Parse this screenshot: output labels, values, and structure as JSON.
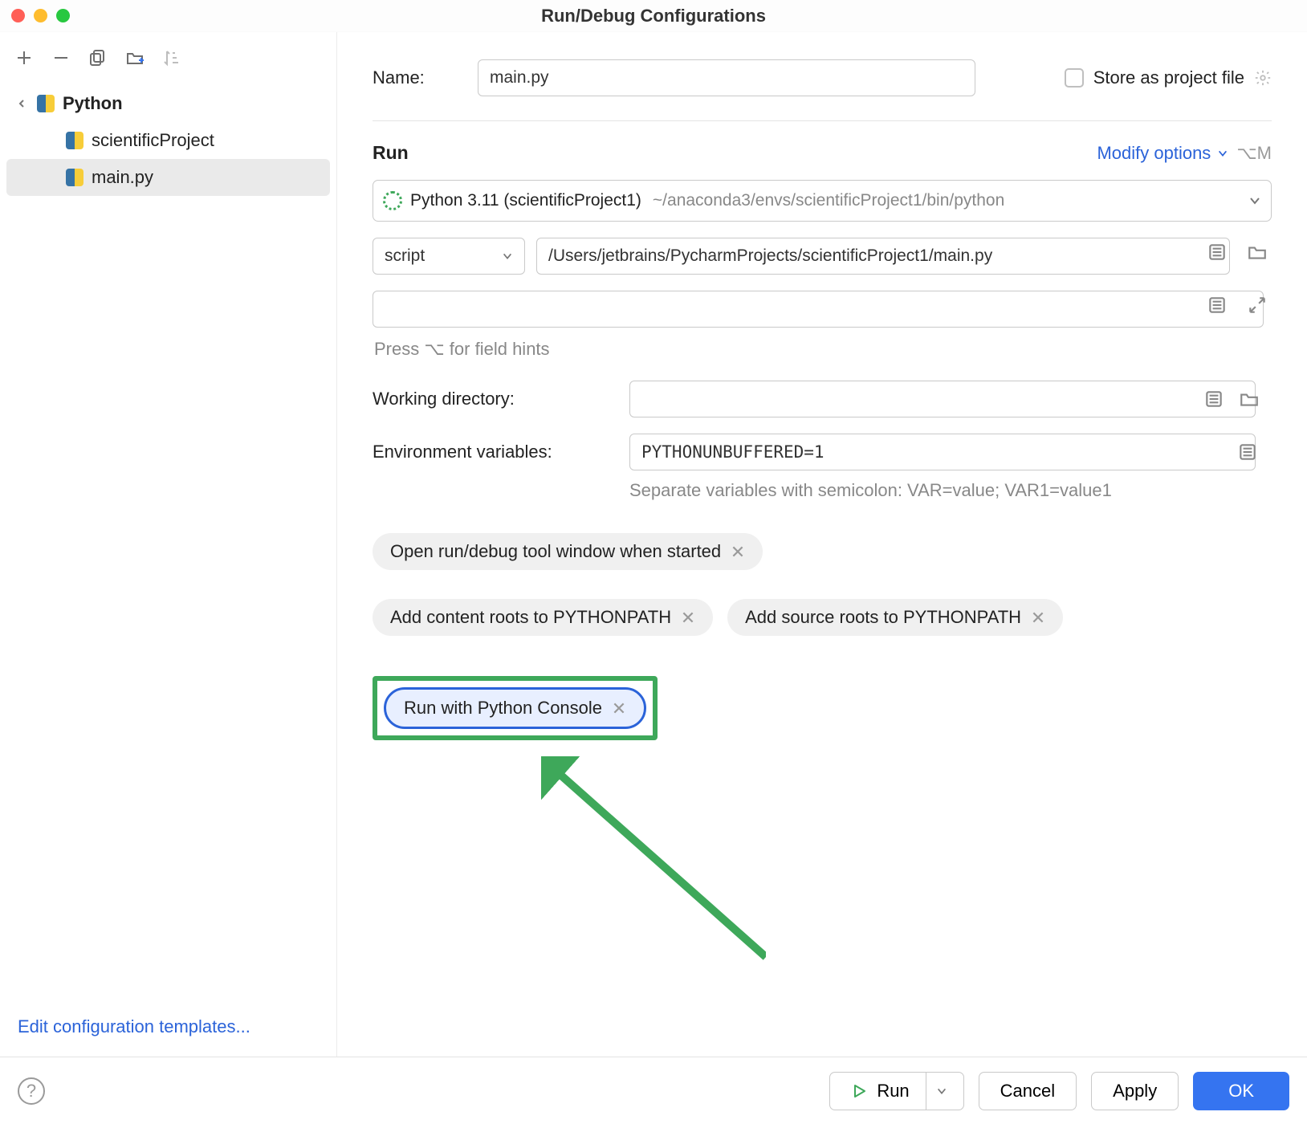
{
  "title": "Run/Debug Configurations",
  "tree": {
    "root": "Python",
    "items": [
      {
        "label": "scientificProject"
      },
      {
        "label": "main.py"
      }
    ]
  },
  "left_footer_link": "Edit configuration templates...",
  "form": {
    "name_label": "Name:",
    "name_value": "main.py",
    "store_label": "Store as project file",
    "section_run": "Run",
    "modify_label": "Modify options",
    "modify_shortcut": "⌥M",
    "interpreter_name": "Python 3.11 (scientificProject1)",
    "interpreter_path": "~/anaconda3/envs/scientificProject1/bin/python",
    "script_select": "script",
    "script_path": "/Users/jetbrains/PycharmProjects/scientificProject1/main.py",
    "hints_text": "Press ⌥ for field hints",
    "wd_label": "Working directory:",
    "wd_value": "",
    "env_label": "Environment variables:",
    "env_value": "PYTHONUNBUFFERED=1",
    "env_hint": "Separate variables with semicolon: VAR=value; VAR1=value1"
  },
  "chips": [
    "Open run/debug tool window when started",
    "Add content roots to PYTHONPATH",
    "Add source roots to PYTHONPATH",
    "Run with Python Console"
  ],
  "footer": {
    "run": "Run",
    "cancel": "Cancel",
    "apply": "Apply",
    "ok": "OK"
  }
}
